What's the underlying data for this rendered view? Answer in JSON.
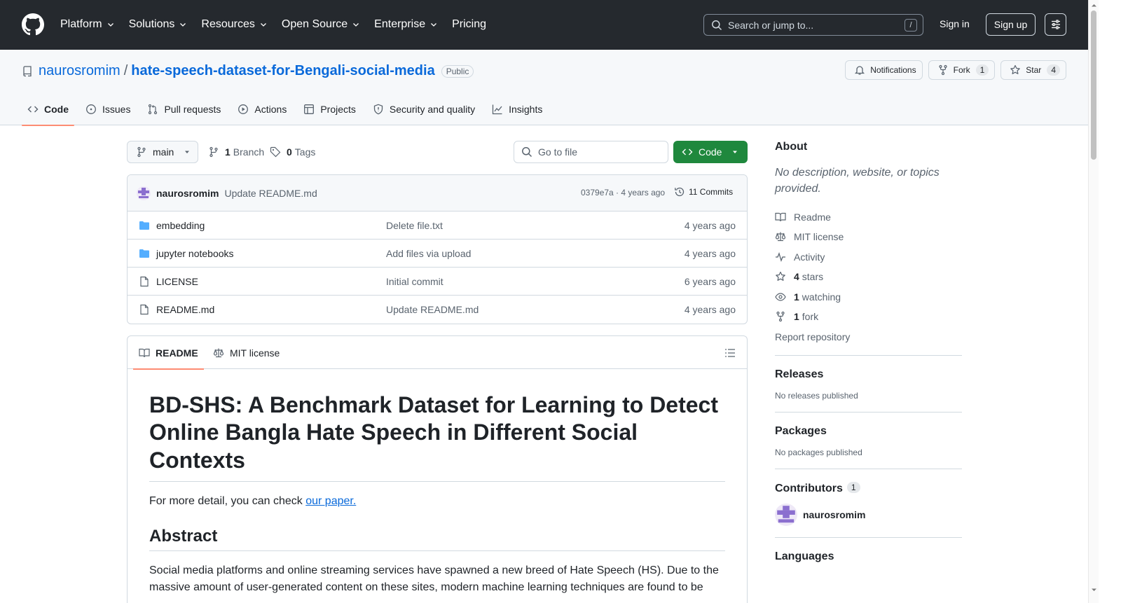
{
  "header": {
    "nav": [
      {
        "label": "Platform",
        "has_menu": true
      },
      {
        "label": "Solutions",
        "has_menu": true
      },
      {
        "label": "Resources",
        "has_menu": true
      },
      {
        "label": "Open Source",
        "has_menu": true
      },
      {
        "label": "Enterprise",
        "has_menu": true
      },
      {
        "label": "Pricing",
        "has_menu": false
      }
    ],
    "search_placeholder": "Search or jump to...",
    "search_shortcut": "/",
    "sign_in": "Sign in",
    "sign_up": "Sign up"
  },
  "repo": {
    "owner": "naurosromim",
    "separator": "/",
    "name": "hate-speech-dataset-for-Bengali-social-media",
    "visibility": "Public",
    "notifications_label": "Notifications",
    "fork_label": "Fork",
    "fork_count": "1",
    "star_label": "Star",
    "star_count": "4",
    "tabs": [
      {
        "label": "Code",
        "icon": "code-icon",
        "active": true
      },
      {
        "label": "Issues",
        "icon": "issue-icon"
      },
      {
        "label": "Pull requests",
        "icon": "pull-request-icon"
      },
      {
        "label": "Actions",
        "icon": "play-icon"
      },
      {
        "label": "Projects",
        "icon": "table-icon"
      },
      {
        "label": "Security and quality",
        "icon": "shield-icon"
      },
      {
        "label": "Insights",
        "icon": "graph-icon"
      }
    ]
  },
  "toolbar": {
    "branch": "main",
    "branch_count": "1",
    "branch_label": "Branch",
    "tag_count": "0",
    "tag_label": "Tags",
    "goto_file_placeholder": "Go to file",
    "code_button": "Code"
  },
  "latest_commit": {
    "author": "naurosromim",
    "message": "Update README.md",
    "sha_and_age": "0379e7a · 4 years ago",
    "commits_label": "11 Commits"
  },
  "files": [
    {
      "type": "folder",
      "name": "embedding",
      "message": "Delete file.txt",
      "date": "4 years ago"
    },
    {
      "type": "folder",
      "name": "jupyter notebooks",
      "message": "Add files via upload",
      "date": "4 years ago"
    },
    {
      "type": "file",
      "name": "LICENSE",
      "message": "Initial commit",
      "date": "6 years ago"
    },
    {
      "type": "file",
      "name": "README.md",
      "message": "Update README.md",
      "date": "4 years ago"
    }
  ],
  "readme": {
    "tab_readme": "README",
    "tab_license": "MIT license",
    "title": "BD-SHS: A Benchmark Dataset for Learning to Detect Online Bangla Hate Speech in Different Social Contexts",
    "intro_text": "For more detail, you can check ",
    "intro_link": "our paper.",
    "abstract_heading": "Abstract",
    "abstract_text": "Social media platforms and online streaming services have spawned a new breed of Hate Speech (HS). Due to the massive amount of user-generated content on these sites, modern machine learning techniques are found to be"
  },
  "sidebar": {
    "about_heading": "About",
    "about_desc": "No description, website, or topics provided.",
    "links": [
      {
        "icon": "book-icon",
        "bold": "",
        "text": "Readme"
      },
      {
        "icon": "law-icon",
        "bold": "",
        "text": "MIT license"
      },
      {
        "icon": "pulse-icon",
        "bold": "",
        "text": "Activity"
      },
      {
        "icon": "star-icon",
        "bold": "4",
        "text": "stars"
      },
      {
        "icon": "eye-icon",
        "bold": "1",
        "text": "watching"
      },
      {
        "icon": "fork-icon",
        "bold": "1",
        "text": "fork"
      }
    ],
    "report": "Report repository",
    "releases_heading": "Releases",
    "releases_text": "No releases published",
    "packages_heading": "Packages",
    "packages_text": "No packages published",
    "contributors_heading": "Contributors",
    "contributors_count": "1",
    "contributor_name": "naurosromim",
    "languages_heading": "Languages"
  },
  "colors": {
    "header_bg": "#25292e",
    "link": "#0969da",
    "primary_button": "#1f883d",
    "active_tab_underline": "#fd8c73",
    "folder": "#54aeff"
  }
}
